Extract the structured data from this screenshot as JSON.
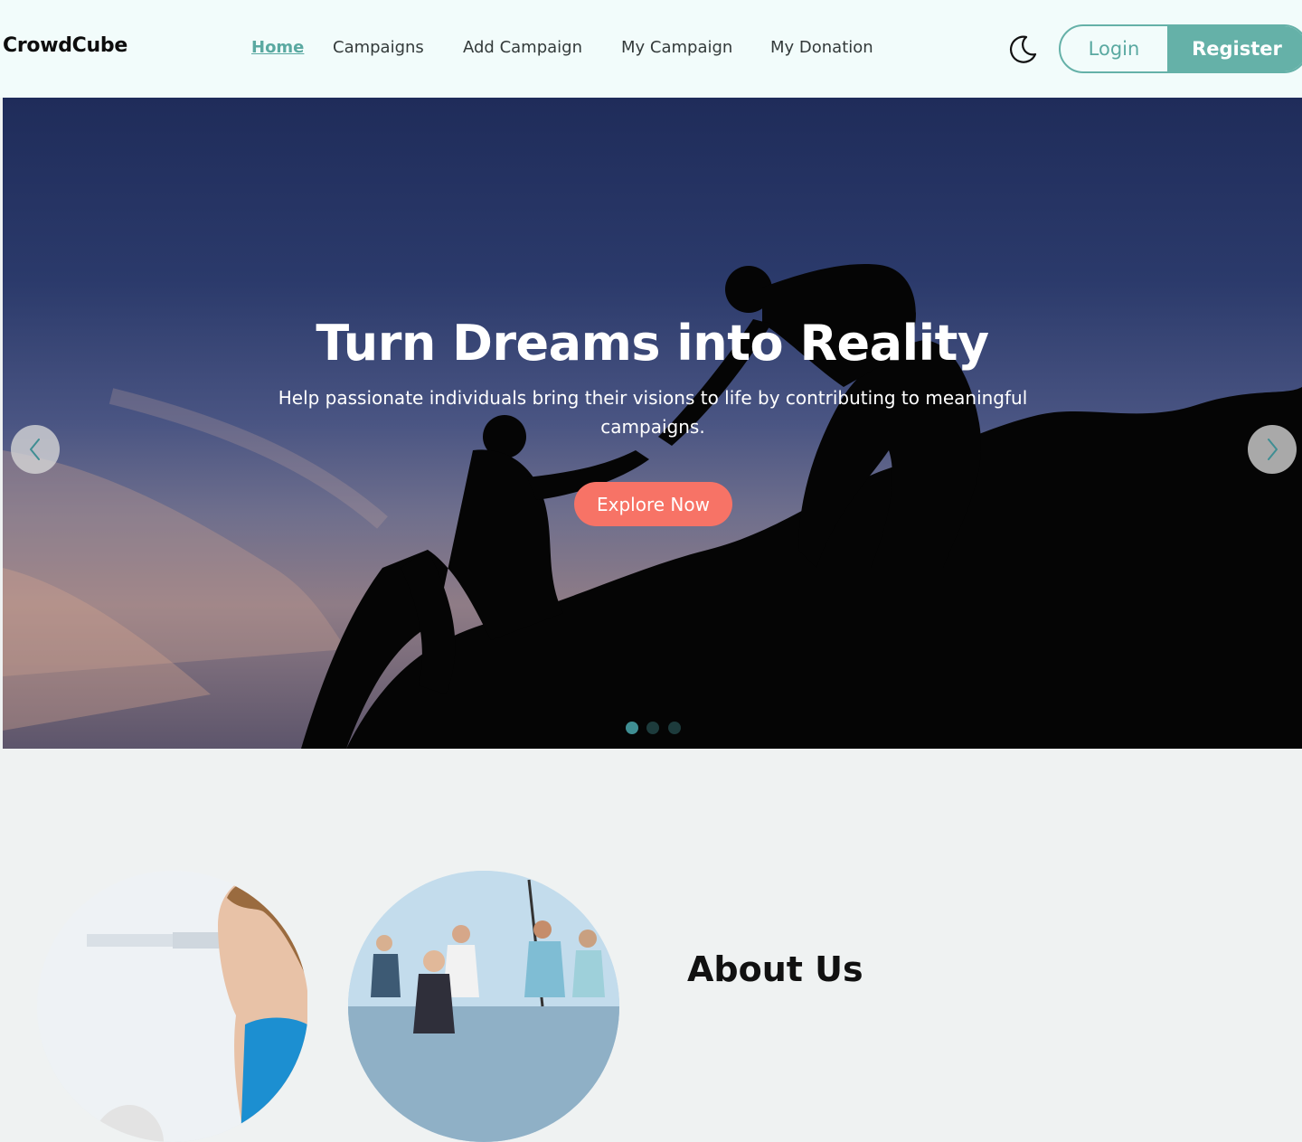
{
  "brand": "CrowdCube",
  "nav": {
    "links": [
      {
        "label": "Home",
        "active": true
      },
      {
        "label": "Campaigns",
        "active": false
      },
      {
        "label": "Add Campaign",
        "active": false
      },
      {
        "label": "My Campaign",
        "active": false
      },
      {
        "label": "My Donation",
        "active": false
      }
    ],
    "theme_toggle_icon": "moon-icon",
    "login_label": "Login",
    "register_label": "Register"
  },
  "hero": {
    "title": "Turn Dreams into Reality",
    "subtitle": "Help passionate individuals bring their visions to life by contributing to meaningful campaigns.",
    "cta_label": "Explore Now",
    "slides_count": 3,
    "active_slide": 1,
    "prev_icon": "chevron-left-icon",
    "next_icon": "chevron-right-icon"
  },
  "about": {
    "title": "About Us"
  },
  "colors": {
    "accent": "#65b1a8",
    "cta": "#f77366",
    "nav_bg": "#f2fcfb",
    "page_bg": "#eff2f2"
  }
}
